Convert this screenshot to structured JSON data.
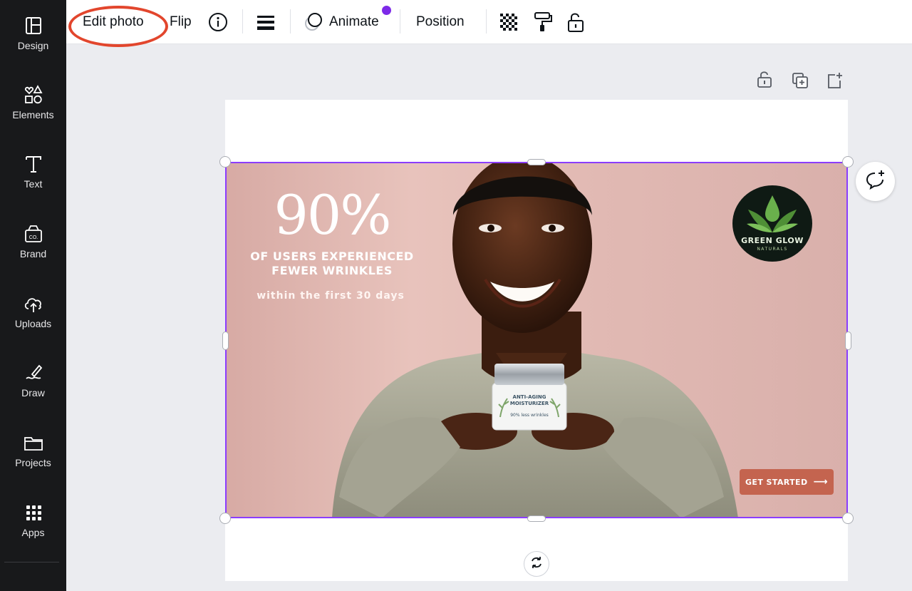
{
  "sidebar": {
    "items": [
      {
        "label": "Design",
        "icon": "layout-icon"
      },
      {
        "label": "Elements",
        "icon": "shapes-icon"
      },
      {
        "label": "Text",
        "icon": "text-icon"
      },
      {
        "label": "Brand",
        "icon": "brand-icon"
      },
      {
        "label": "Uploads",
        "icon": "cloud-upload-icon"
      },
      {
        "label": "Draw",
        "icon": "pen-icon"
      },
      {
        "label": "Projects",
        "icon": "folder-icon"
      },
      {
        "label": "Apps",
        "icon": "grid-icon"
      }
    ]
  },
  "toolbar": {
    "edit_photo": "Edit photo",
    "flip": "Flip",
    "animate": "Animate",
    "position": "Position"
  },
  "design": {
    "headline": "90%",
    "subheadline_line1": "OF USERS EXPERIENCED",
    "subheadline_line2": "FEWER WRINKLES",
    "tagline": "within the first 30 days",
    "logo_name": "GREEN GLOW",
    "logo_sub": "NATURALS",
    "jar_title_line1": "ANTI-AGING",
    "jar_title_line2": "MOISTURIZER",
    "jar_sub": "90% less wrinkles",
    "cta": "GET STARTED",
    "cta_arrow": "⟶"
  },
  "colors": {
    "sidebar_bg": "#18191b",
    "selection": "#8b3dff",
    "highlight_ring": "#e2462d",
    "cta_bg": "#c4644f",
    "notification_dot": "#7d2ae8"
  }
}
